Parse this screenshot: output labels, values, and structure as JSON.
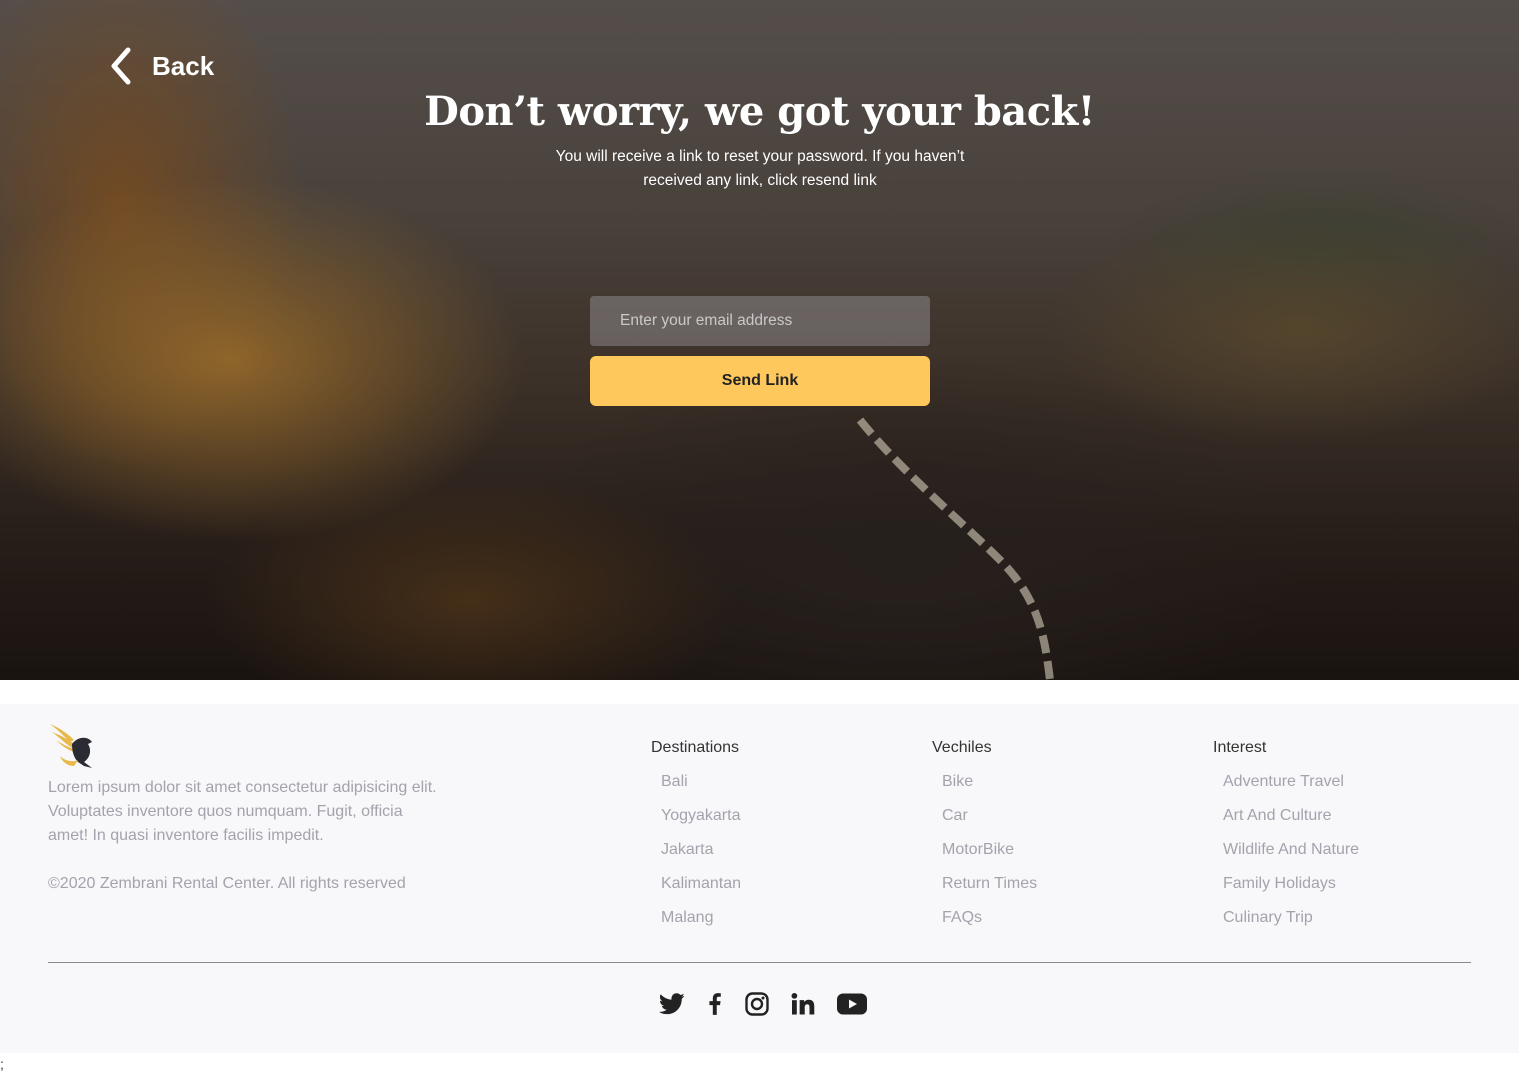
{
  "nav": {
    "back_label": "Back"
  },
  "hero": {
    "title": "Don’t worry, we got your back!",
    "subtitle": "You will receive a link to reset your password. If you haven’t received any link, click resend link",
    "email_placeholder": "Enter your email address",
    "send_label": "Send Link",
    "accent_color": "#ffc85c"
  },
  "footer": {
    "logo_icon": "pegasus-logo-icon",
    "about": "Lorem ipsum dolor sit amet consectetur adipisicing elit. Voluptates inventore quos numquam. Fugit, officia amet! In quasi inventore facilis impedit.",
    "copyright": "©2020 Zembrani Rental Center. All rights reserved",
    "columns": [
      {
        "title": "Destinations",
        "items": [
          "Bali",
          "Yogyakarta",
          "Jakarta",
          "Kalimantan",
          "Malang"
        ]
      },
      {
        "title": "Vechiles",
        "items": [
          "Bike",
          "Car",
          "MotorBike",
          "Return Times",
          "FAQs"
        ]
      },
      {
        "title": "Interest",
        "items": [
          "Adventure Travel",
          "Art And Culture",
          "Wildlife And Nature",
          "Family Holidays",
          "Culinary Trip"
        ]
      }
    ],
    "social_icons": [
      "twitter-icon",
      "facebook-icon",
      "instagram-icon",
      "linkedin-icon",
      "youtube-icon"
    ]
  },
  "stray_text": ";"
}
